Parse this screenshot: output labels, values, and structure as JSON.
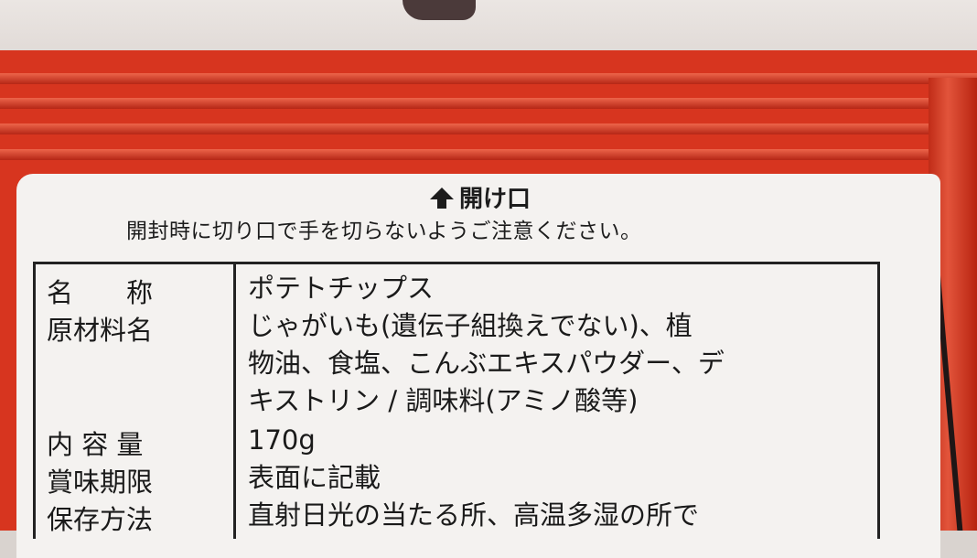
{
  "package": {
    "open_label": "開け口",
    "warning": "開封時に切り口で手を切らないようご注意ください。"
  },
  "rows": [
    {
      "label": "名　　称",
      "value_lines": [
        "ポテトチップス"
      ]
    },
    {
      "label": "原材料名",
      "value_lines": [
        "じゃがいも(遺伝子組換えでない)、植",
        "物油、食塩、こんぶエキスパウダー、デ",
        "キストリン / 調味料(アミノ酸等)"
      ]
    },
    {
      "label": "内 容 量",
      "value_lines": [
        "170g"
      ]
    },
    {
      "label": "賞味期限",
      "value_lines": [
        "表面に記載"
      ]
    },
    {
      "label": "保存方法",
      "value_lines": [
        "直射日光の当たる所、高温多湿の所で"
      ]
    }
  ],
  "colors": {
    "bag_red": "#d7351f",
    "panel": "#f4f2f0",
    "text": "#1a1a1a"
  },
  "icons": {
    "open_arrow": "arrow-up-icon"
  }
}
